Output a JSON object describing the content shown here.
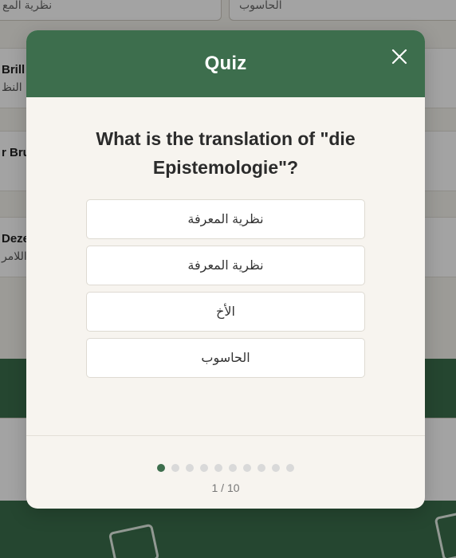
{
  "background": {
    "inputs": [
      {
        "value": "نظرية المع"
      },
      {
        "value": "الحاسوب"
      }
    ],
    "cards": [
      {
        "term": "Brill",
        "translation": "النظ"
      },
      {
        "term": "r Bruc",
        "translation": ""
      },
      {
        "term": "Deze",
        "translation": "اللامر"
      }
    ]
  },
  "quiz": {
    "title": "Quiz",
    "question": "What is the translation of \"die Epistemologie\"?",
    "options": [
      {
        "label": "نظرية المعرفة"
      },
      {
        "label": "نظرية المعرفة"
      },
      {
        "label": "الأخ"
      },
      {
        "label": "الحاسوب"
      }
    ],
    "progress": {
      "current": 1,
      "total": 10,
      "label": "1 / 10"
    }
  },
  "colors": {
    "accent": "#3d6e4d",
    "modal_background": "#f7f4ef",
    "dot_inactive": "#d9d9d9"
  },
  "icons": {
    "close": "close-icon"
  }
}
